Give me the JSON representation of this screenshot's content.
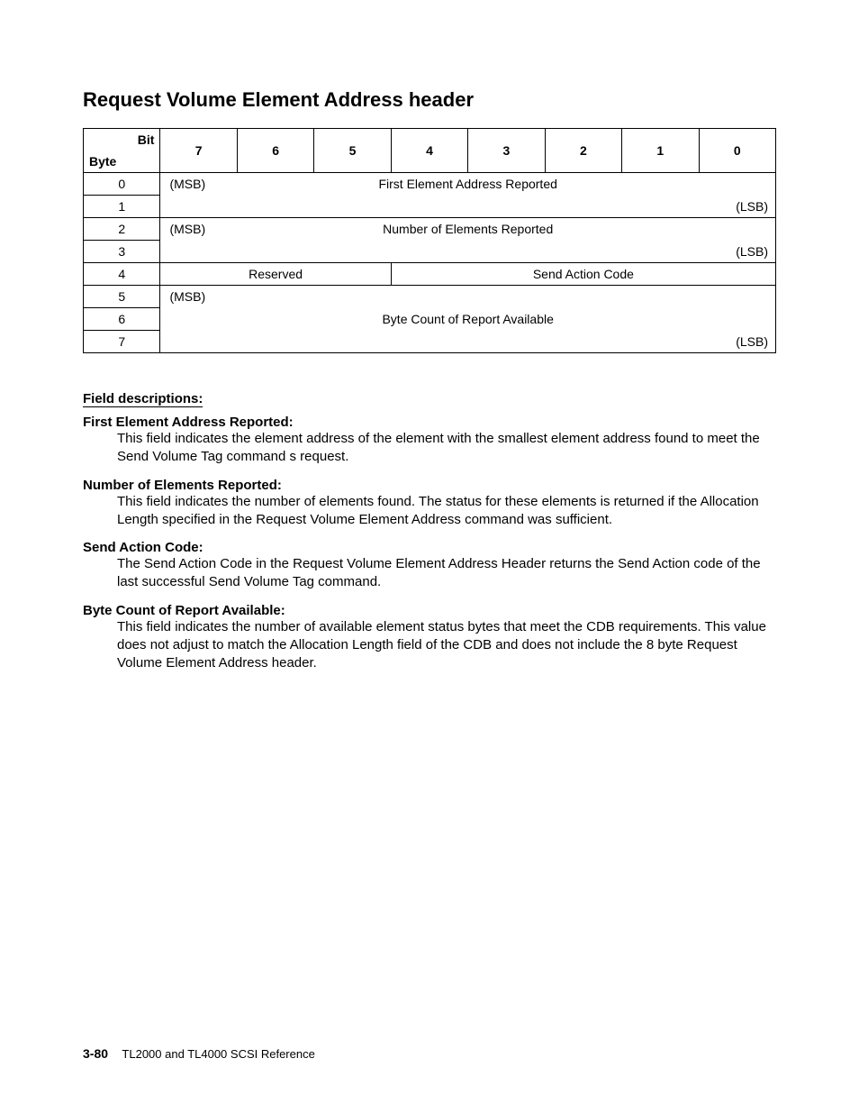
{
  "title": "Request Volume Element Address header",
  "table": {
    "hdr_bit": "Bit",
    "hdr_byte": "Byte",
    "bits": [
      "7",
      "6",
      "5",
      "4",
      "3",
      "2",
      "1",
      "0"
    ],
    "bytes": [
      "0",
      "1",
      "2",
      "3",
      "4",
      "5",
      "6",
      "7"
    ],
    "msb": "(MSB)",
    "lsb": "(LSB)",
    "first_elem": "First Element Address Reported",
    "num_elem": "Number of Elements Reported",
    "reserved": "Reserved",
    "send_action": "Send Action Code",
    "byte_count": "Byte Count of Report Available"
  },
  "field_desc_heading": "Field descriptions:",
  "fields": [
    {
      "name": "First Element Address Reported:",
      "text": "This field indicates the element address of the element with the smallest element address found to meet the Send Volume Tag command s request."
    },
    {
      "name": "Number of Elements Reported:",
      "text": "This field indicates the number of elements found. The status for these elements is returned if the Allocation Length specified in the Request Volume Element Address command was sufficient."
    },
    {
      "name": "Send Action Code:",
      "text": "The Send Action Code in the Request Volume Element Address Header returns the Send Action code of the last successful Send Volume Tag command."
    },
    {
      "name": "Byte Count of Report Available:",
      "text": "This field indicates the number of available element status bytes that meet the CDB requirements. This value does not adjust to match the Allocation Length field of the CDB and does not include the 8 byte Request Volume Element Address header."
    }
  ],
  "footer": {
    "page_num": "3-80",
    "doc_title": "TL2000 and TL4000 SCSI Reference"
  }
}
